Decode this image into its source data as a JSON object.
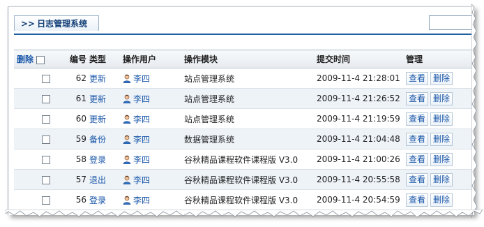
{
  "header": {
    "arrows": ">>",
    "title": "日志管理系统"
  },
  "table": {
    "columns": {
      "delete": "删除",
      "id": "编号",
      "type": "类型",
      "user": "操作用户",
      "module": "操作模块",
      "time": "提交时间",
      "manage": "管理"
    },
    "rows": [
      {
        "id": "62",
        "type": "更新",
        "user": "李四",
        "module": "站点管理系统",
        "time": "2009-11-4 21:28:01",
        "view": "查看",
        "delete": "删除"
      },
      {
        "id": "61",
        "type": "更新",
        "user": "李四",
        "module": "站点管理系统",
        "time": "2009-11-4 21:26:52",
        "view": "查看",
        "delete": "删除"
      },
      {
        "id": "60",
        "type": "更新",
        "user": "李四",
        "module": "站点管理系统",
        "time": "2009-11-4 21:19:59",
        "view": "查看",
        "delete": "删除"
      },
      {
        "id": "59",
        "type": "备份",
        "user": "李四",
        "module": "数据管理系统",
        "time": "2009-11-4 21:04:48",
        "view": "查看",
        "delete": "删除"
      },
      {
        "id": "58",
        "type": "登录",
        "user": "李四",
        "module": "谷秋精品课程软件课程版 V3.0",
        "time": "2009-11-4 21:00:26",
        "view": "查看",
        "delete": "删除"
      },
      {
        "id": "57",
        "type": "退出",
        "user": "李四",
        "module": "谷秋精品课程软件课程版 V3.0",
        "time": "2009-11-4 20:55:58",
        "view": "查看",
        "delete": "删除"
      },
      {
        "id": "56",
        "type": "登录",
        "user": "李四",
        "module": "谷秋精品课程软件课程版 V3.0",
        "time": "2009-11-4 20:54:59",
        "view": "查看",
        "delete": "删除"
      }
    ]
  },
  "icons": {
    "user": "user-icon",
    "checkbox": "checkbox"
  },
  "colors": {
    "accent": "#1e5fa0",
    "link": "#1a57a8",
    "row_alt": "#eef3f8"
  }
}
